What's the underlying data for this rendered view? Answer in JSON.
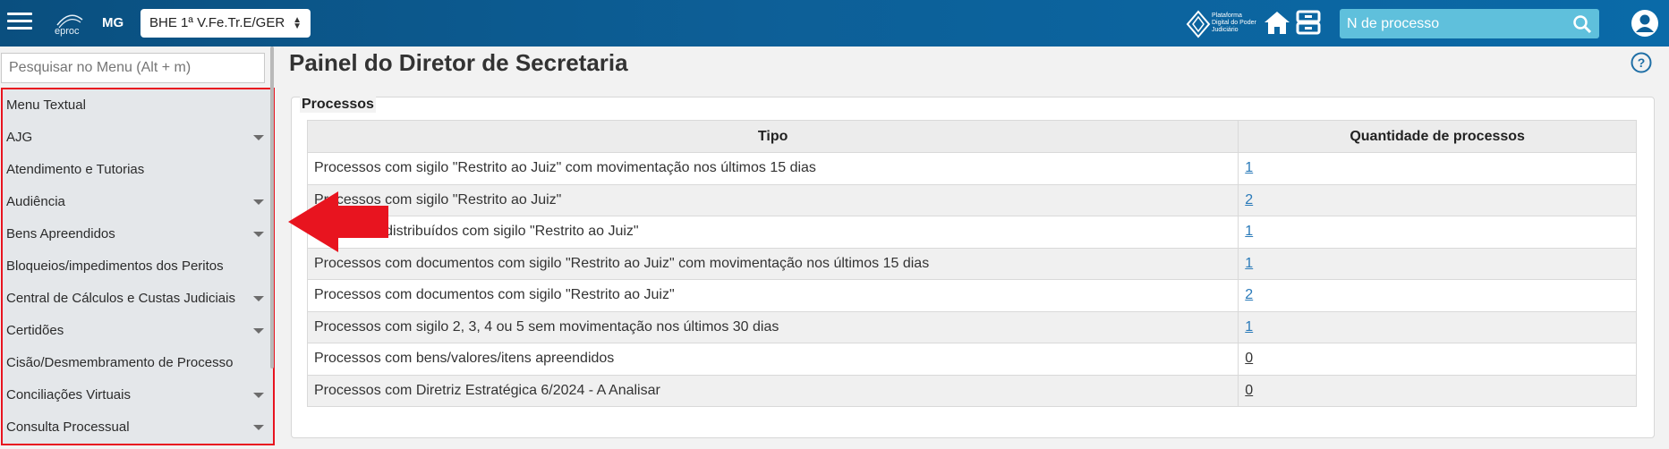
{
  "header": {
    "logo_text": "eproc",
    "state": "MG",
    "org_selected": "BHE 1ª V.Fe.Tr.E/GER",
    "pdpj_text": "Plataforma Digital do Poder Judiciário",
    "search_placeholder": "N de processo",
    "colors": {
      "bar": "#0d5f97",
      "search": "#5fc0dc"
    }
  },
  "sidebar": {
    "search_placeholder": "Pesquisar no Menu (Alt + m)",
    "items": [
      {
        "label": "Menu Textual",
        "expandable": false
      },
      {
        "label": "AJG",
        "expandable": true
      },
      {
        "label": "Atendimento e Tutorias",
        "expandable": false
      },
      {
        "label": "Audiência",
        "expandable": true
      },
      {
        "label": "Bens Apreendidos",
        "expandable": true
      },
      {
        "label": "Bloqueios/impedimentos dos Peritos",
        "expandable": false
      },
      {
        "label": "Central de Cálculos e Custas Judiciais",
        "expandable": true
      },
      {
        "label": "Certidões",
        "expandable": true
      },
      {
        "label": "Cisão/Desmembramento de Processo",
        "expandable": false
      },
      {
        "label": "Conciliações Virtuais",
        "expandable": true
      },
      {
        "label": "Consulta Processual",
        "expandable": true
      }
    ],
    "highlight_color": "#e8141f"
  },
  "main": {
    "title": "Painel do Diretor de Secretaria",
    "panel_legend": "Processos",
    "columns": [
      "Tipo",
      "Quantidade de processos"
    ],
    "rows": [
      {
        "tipo": "Processos com sigilo \"Restrito ao Juiz\" com movimentação nos últimos 15 dias",
        "qtd": "1"
      },
      {
        "tipo": "Processos com sigilo \"Restrito ao Juiz\"",
        "qtd": "2"
      },
      {
        "tipo": "Processos distribuídos com sigilo \"Restrito ao Juiz\"",
        "qtd": "1"
      },
      {
        "tipo": "Processos com documentos com sigilo \"Restrito ao Juiz\" com movimentação nos últimos 15 dias",
        "qtd": "1"
      },
      {
        "tipo": "Processos com documentos com sigilo \"Restrito ao Juiz\"",
        "qtd": "2"
      },
      {
        "tipo": "Processos com sigilo 2, 3, 4 ou 5 sem movimentação nos últimos 30 dias",
        "qtd": "1"
      },
      {
        "tipo": "Processos com bens/valores/itens apreendidos",
        "qtd": "0"
      },
      {
        "tipo": "Processos com Diretriz Estratégica 6/2024 - A Analisar",
        "qtd": "0"
      }
    ]
  }
}
